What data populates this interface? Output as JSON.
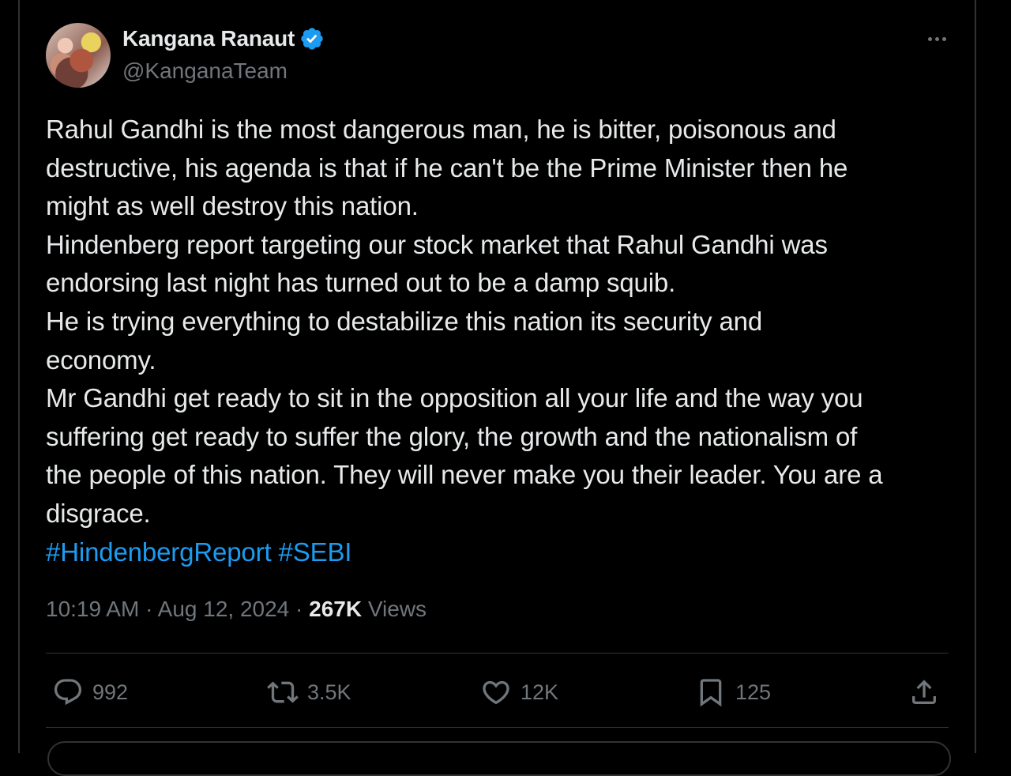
{
  "author": {
    "name": "Kangana Ranaut",
    "handle": "@KanganaTeam",
    "verified": true,
    "avatar_icon": "profile-photo"
  },
  "menu": {
    "icon": "more-horizontal-icon"
  },
  "tweet": {
    "lines": [
      "Rahul Gandhi is the most dangerous man, he is bitter, poisonous and",
      "destructive, his agenda is that if he can't be the Prime Minister then he",
      "might as well destroy this nation.",
      "Hindenberg report targeting our stock market that Rahul Gandhi was",
      "endorsing last night has turned out to be a damp squib.",
      "He is trying everything to destabilize this nation its security and",
      "economy.",
      "Mr Gandhi get ready to sit in the opposition all your life and the way you",
      "suffering get ready to suffer the glory, the growth and the nationalism of",
      "the people of this nation. They will never make you their leader. You are a",
      "disgrace."
    ],
    "hashtags": [
      "#HindenbergReport",
      "#SEBI"
    ]
  },
  "meta": {
    "time": "10:19 AM",
    "separator": " · ",
    "date": "Aug 12, 2024",
    "views_count": "267K",
    "views_label": " Views"
  },
  "actions": {
    "replies": "992",
    "reposts": "3.5K",
    "likes": "12K",
    "bookmarks": "125"
  },
  "colors": {
    "background": "#000000",
    "text": "#e7e9ea",
    "secondary": "#71767b",
    "accent": "#1d9bf0",
    "border": "#2f3336"
  }
}
